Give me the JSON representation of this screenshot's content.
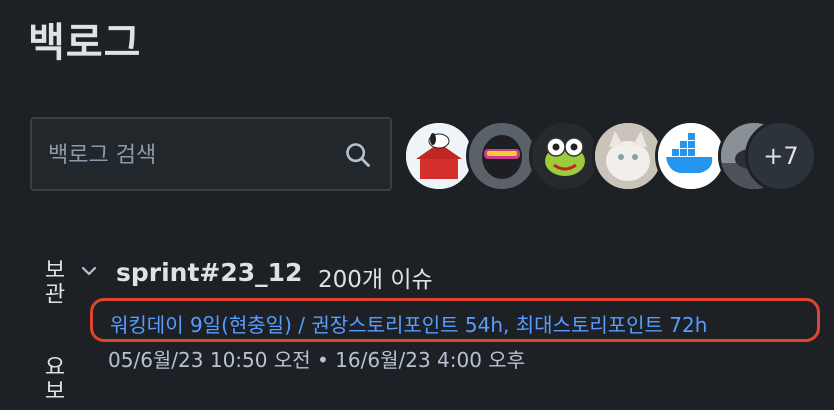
{
  "page": {
    "title": "백로그"
  },
  "search": {
    "placeholder": "백로그 검색"
  },
  "avatars": {
    "items": [
      {
        "name": "snoopy-avatar"
      },
      {
        "name": "robot-avatar"
      },
      {
        "name": "frog-avatar"
      },
      {
        "name": "cat-avatar"
      },
      {
        "name": "docker-avatar"
      },
      {
        "name": "bird-avatar"
      }
    ],
    "more_label": "+7"
  },
  "side_tags": {
    "top": "보관",
    "bottom": "요보"
  },
  "sprint": {
    "name": "sprint#23_12",
    "issue_count": "200개 이슈",
    "goal": "워킹데이 9일(현충일) / 권장스토리포인트 54h, 최대스토리포인트 72h",
    "dates": "05/6월/23 10:50 오전  •  16/6월/23 4:00 오후"
  },
  "colors": {
    "background": "#1d2125",
    "link": "#579dff",
    "highlight_border": "#e0452e"
  }
}
